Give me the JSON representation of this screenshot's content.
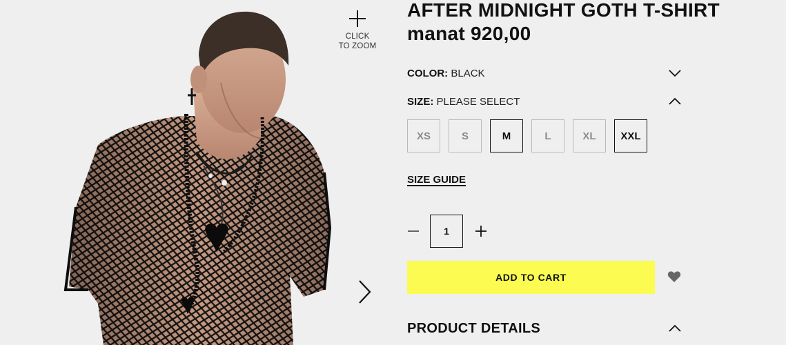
{
  "gallery": {
    "zoom_label_line1": "CLICK",
    "zoom_label_line2": "TO ZOOM",
    "photo_alt": "Model wearing black fishnet t-shirt",
    "zoom_icon": "plus-icon",
    "next_icon": "chevron-right-icon"
  },
  "product": {
    "title": "AFTER MIDNIGHT GOTH T-SHIRT",
    "price": "manat 920,00"
  },
  "color": {
    "label": "COLOR:",
    "value": "BLACK",
    "icon": "chevron-down-icon"
  },
  "size": {
    "label": "SIZE:",
    "value": "PLEASE SELECT",
    "icon": "chevron-up-icon",
    "options": [
      {
        "label": "XS",
        "available": false
      },
      {
        "label": "S",
        "available": false
      },
      {
        "label": "M",
        "available": true
      },
      {
        "label": "L",
        "available": false
      },
      {
        "label": "XL",
        "available": false
      },
      {
        "label": "XXL",
        "available": true
      }
    ]
  },
  "size_guide_label": "SIZE GUIDE",
  "quantity": {
    "value": "1",
    "minus_icon": "minus-icon",
    "plus_icon": "plus-icon"
  },
  "cart": {
    "add_label": "ADD TO CART",
    "wishlist_icon": "heart-icon"
  },
  "details": {
    "label": "PRODUCT DETAILS",
    "icon": "chevron-up-icon"
  },
  "colors": {
    "background": "#efeff0",
    "cart_button": "#fbfb52",
    "text": "#111111",
    "unavailable_size": "#8b8b8c"
  }
}
